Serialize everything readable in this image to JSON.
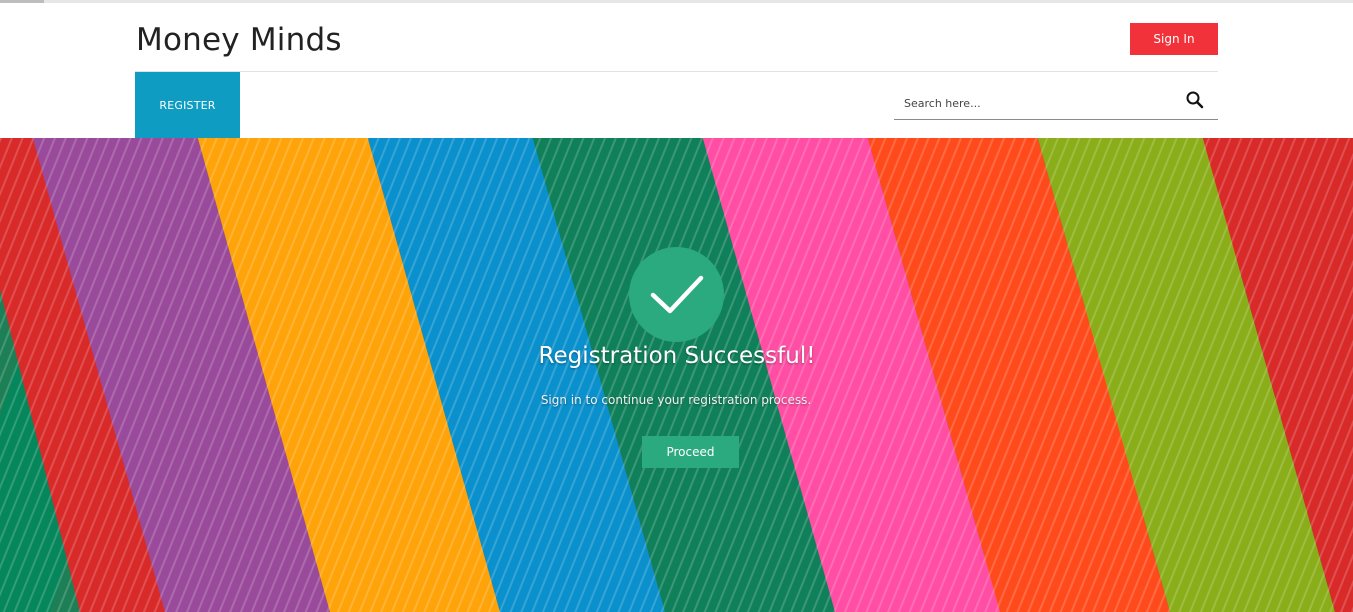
{
  "header": {
    "brand": "Money Minds",
    "signin_label": "Sign In"
  },
  "nav": {
    "register_label": "REGISTER"
  },
  "search": {
    "placeholder": "Search here...",
    "icon": "search-icon"
  },
  "hero": {
    "icon": "checkmark-icon",
    "title": "Registration Successful!",
    "subtitle": "Sign in to continue your registration process.",
    "proceed_label": "Proceed"
  },
  "colors": {
    "brand_red": "#f2323a",
    "nav_blue": "#0e9cc3",
    "success_green": "#2baa7f"
  }
}
